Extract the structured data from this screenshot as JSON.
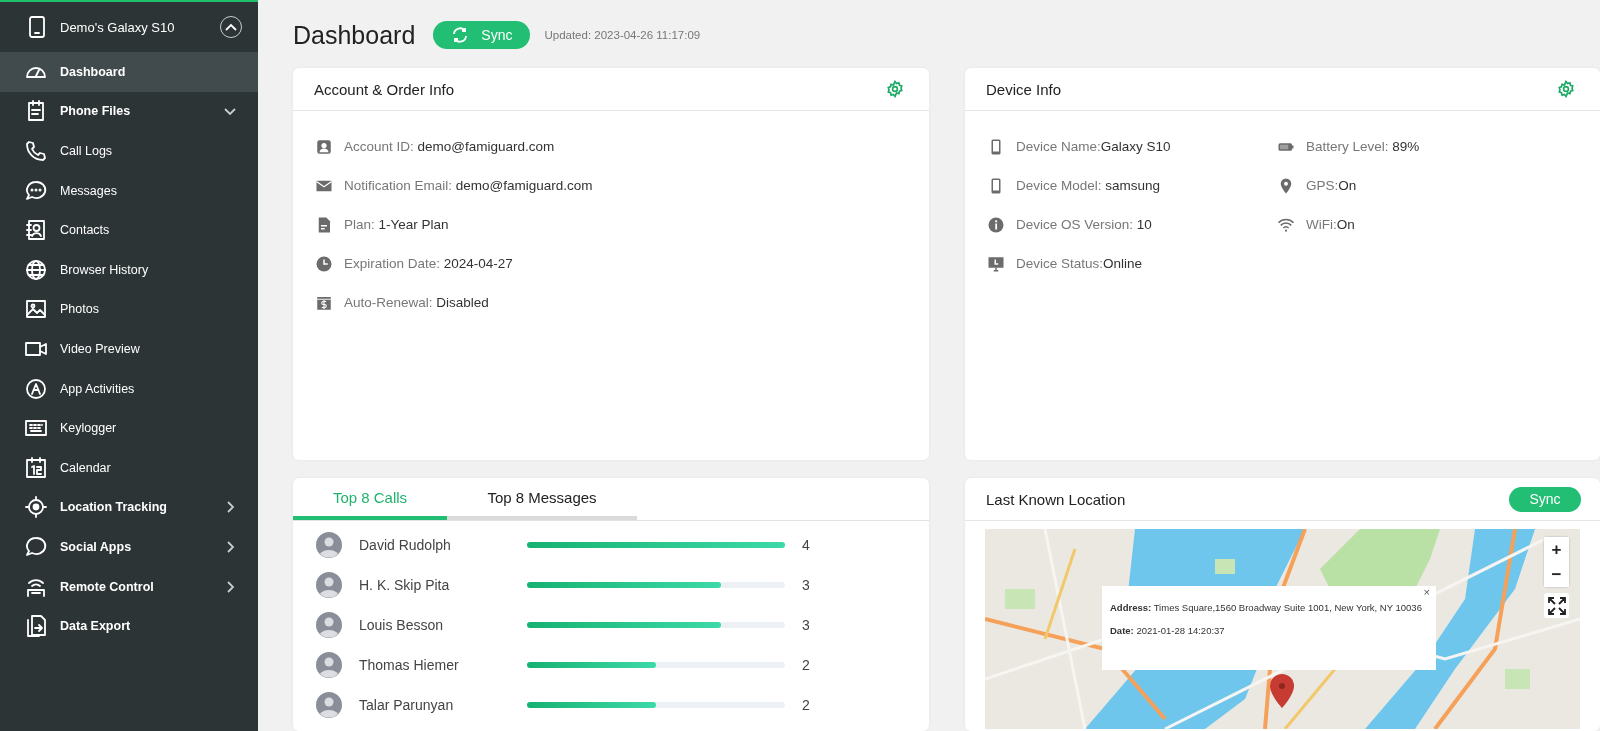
{
  "sidebar": {
    "device": {
      "name": "Demo's Galaxy S10",
      "expanded": true
    },
    "items": [
      {
        "label": "Dashboard",
        "kind": "section",
        "selected": true
      },
      {
        "label": "Phone Files",
        "kind": "section",
        "selected": false,
        "expanded": true
      },
      {
        "label": "Call Logs",
        "kind": "sub",
        "selected": false
      },
      {
        "label": "Messages",
        "kind": "sub",
        "selected": false
      },
      {
        "label": "Contacts",
        "kind": "sub",
        "selected": false
      },
      {
        "label": "Browser History",
        "kind": "sub",
        "selected": false
      },
      {
        "label": "Photos",
        "kind": "sub",
        "selected": false
      },
      {
        "label": "Video Preview",
        "kind": "sub",
        "selected": false
      },
      {
        "label": "App Activities",
        "kind": "sub",
        "selected": false
      },
      {
        "label": "Keylogger",
        "kind": "sub",
        "selected": false
      },
      {
        "label": "Calendar",
        "kind": "sub",
        "selected": false
      },
      {
        "label": "Location Tracking",
        "kind": "section",
        "selected": false,
        "expanded": false
      },
      {
        "label": "Social Apps",
        "kind": "section",
        "selected": false,
        "expanded": false
      },
      {
        "label": "Remote Control",
        "kind": "section",
        "selected": false,
        "expanded": false
      },
      {
        "label": "Data Export",
        "kind": "section",
        "selected": false
      }
    ]
  },
  "header": {
    "title": "Dashboard",
    "sync_button": "Sync",
    "updated": "Updated: 2023-04-26 11:17:09"
  },
  "account_card": {
    "title": "Account & Order Info",
    "rows": [
      {
        "label": "Account ID: ",
        "value": "demo@famiguard.com"
      },
      {
        "label": "Notification Email: ",
        "value": "demo@famiguard.com"
      },
      {
        "label": "Plan: ",
        "value": "1-Year Plan"
      },
      {
        "label": "Expiration Date: ",
        "value": "2024-04-27"
      },
      {
        "label": "Auto-Renewal: ",
        "value": "Disabled"
      }
    ]
  },
  "device_card": {
    "title": "Device Info",
    "columns": [
      [
        {
          "label": "Device Name:",
          "value": "Galaxy S10"
        },
        {
          "label": "Device Model: ",
          "value": "samsung"
        },
        {
          "label": "Device OS Version: ",
          "value": "10"
        },
        {
          "label": "Device Status:",
          "value": "Online"
        }
      ],
      [
        {
          "label": "Battery Level: ",
          "value": "89%"
        },
        {
          "label": "GPS:",
          "value": "On"
        },
        {
          "label": "WiFi:",
          "value": "On"
        }
      ]
    ]
  },
  "top_card": {
    "tabs": [
      {
        "label": "Top 8 Calls",
        "selected": true
      },
      {
        "label": "Top 8 Messages",
        "selected": false
      }
    ],
    "rows": [
      {
        "name": "David Rudolph",
        "level": 1,
        "count": "4"
      },
      {
        "name": "H. K. Skip Pita",
        "level": 0.75,
        "count": "3"
      },
      {
        "name": "Louis Besson",
        "level": 0.75,
        "count": "3"
      },
      {
        "name": "Thomas Hiemer",
        "level": 0.5,
        "count": "2"
      },
      {
        "name": "Talar Parunyan",
        "level": 0.5,
        "count": "2"
      }
    ]
  },
  "location_card": {
    "title": "Last Known Location",
    "sync_button": "Sync",
    "map": {
      "kind": "picture",
      "zoom_in": "+",
      "zoom_out": "−",
      "popup": {
        "close": "×",
        "address": "**Address:** Times Square,1560 Broadway Suite 1001, New York, NY 10036",
        "date": "**Date:** 2021-01-28 14:20:37"
      }
    }
  }
}
